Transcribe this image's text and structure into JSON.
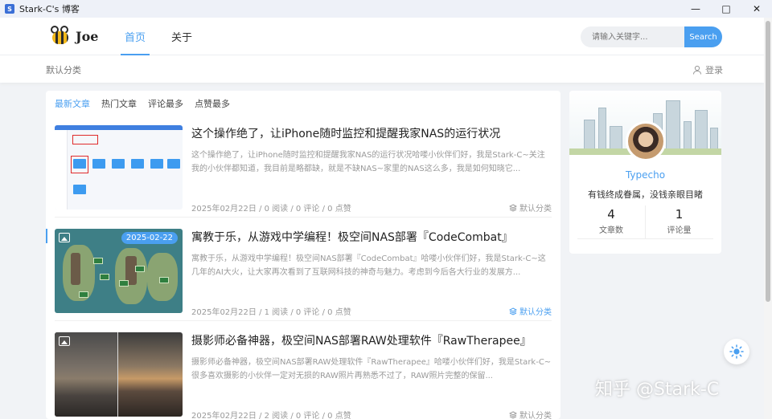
{
  "window": {
    "title": "Stark-C's 博客"
  },
  "header": {
    "logo_text": "Joe",
    "nav": [
      {
        "label": "首页"
      },
      {
        "label": "关于"
      }
    ],
    "search": {
      "placeholder": "请输入关键字...",
      "button": "Search"
    }
  },
  "subbar": {
    "category": "默认分类",
    "login": "登录"
  },
  "main": {
    "tabs": [
      {
        "label": "最新文章"
      },
      {
        "label": "热门文章"
      },
      {
        "label": "评论最多"
      },
      {
        "label": "点赞最多"
      }
    ],
    "posts": [
      {
        "title": "这个操作绝了，让iPhone随时监控和提醒我家NAS的运行状况",
        "excerpt": "这个操作绝了，让iPhone随时监控和提醒我家NAS的运行状况哈喽小伙伴们好，我是Stark-C~关注我的小伙伴都知道，我目前是略都缺，就是不缺NAS~家里的NAS这么多，我是如何知晓它...",
        "meta": "2025年02月22日 / 0 阅读 / 0 评论 / 0 点赞",
        "category": "默认分类",
        "date_badge": ""
      },
      {
        "title": "寓教于乐，从游戏中学编程！极空间NAS部署『CodeCombat』",
        "excerpt": "寓教于乐，从游戏中学编程！极空间NAS部署『CodeCombat』哈喽小伙伴们好，我是Stark-C~这几年的AI大火，让大家再次看到了互联网科技的神奇与魅力。考虑到今后各大行业的发展方...",
        "meta": "2025年02月22日 / 1 阅读 / 0 评论 / 0 点赞",
        "category": "默认分类",
        "date_badge": "2025-02-22"
      },
      {
        "title": "摄影师必备神器，极空间NAS部署RAW处理软件『RawTherapee』",
        "excerpt": "摄影师必备神器，极空间NAS部署RAW处理软件『RawTherapee』哈喽小伙伴们好，我是Stark-C~很多喜欢摄影的小伙伴一定对无损的RAW照片再熟悉不过了，RAW照片完整的保留...",
        "meta": "2025年02月22日 / 2 阅读 / 0 评论 / 0 点赞",
        "category": "默认分类",
        "date_badge": ""
      }
    ]
  },
  "sidebar": {
    "author": "Typecho",
    "motto": "有钱终成眷属，没钱亲眼目睹",
    "stats": [
      {
        "value": "4",
        "label": "文章数"
      },
      {
        "value": "1",
        "label": "评论量"
      }
    ]
  },
  "watermark": "知乎 @Stark-C",
  "colors": {
    "accent": "#4a9ff0",
    "title_bar": "#eef1f8",
    "page_bg": "#f1f3f6"
  }
}
